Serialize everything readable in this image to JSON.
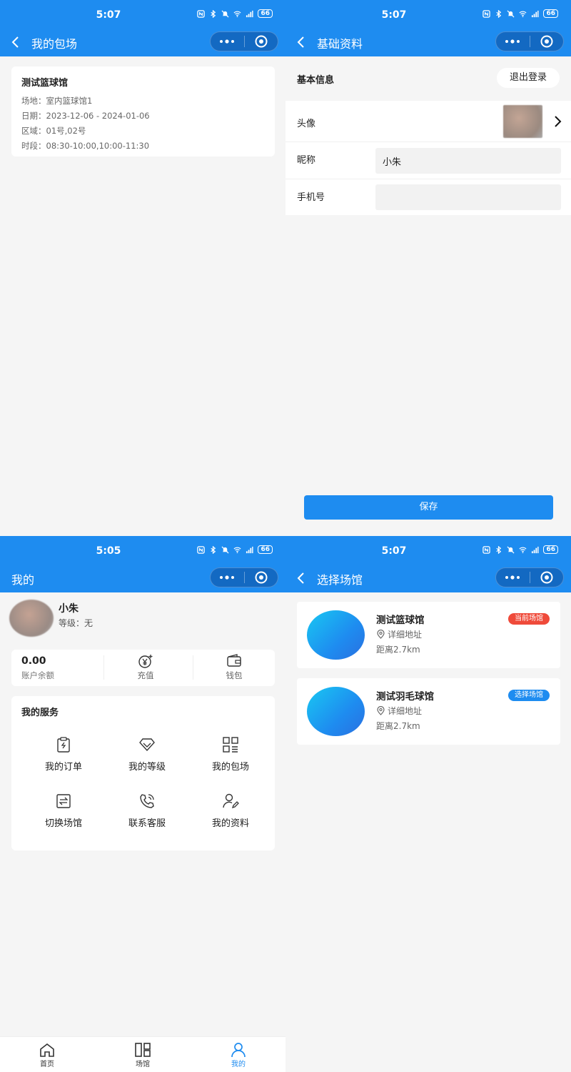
{
  "status": {
    "time_a": "5:07",
    "time_b": "5:05",
    "battery": "66"
  },
  "colors": {
    "brand_blue": "#1e8cf0",
    "current_badge_red": "#ef4a3a",
    "select_badge_blue": "#1e8cf0"
  },
  "screen_booking": {
    "nav_title": "我的包场",
    "card": {
      "name": "测试篮球馆",
      "venue_line": "场地：室内篮球馆1",
      "date_line": "日期：2023-12-06 - 2024-01-06",
      "area_line": "区域：01号,02号",
      "slot_line": "时段：08:30-10:00,10:00-11:30"
    }
  },
  "screen_profile_edit": {
    "nav_title": "基础资料",
    "section_title": "基本信息",
    "logout_label": "退出登录",
    "avatar_label": "头像",
    "nickname_label": "昵称",
    "nickname_value": "小朱",
    "phone_label": "手机号",
    "phone_value": "",
    "save_label": "保存"
  },
  "screen_mine": {
    "nav_title": "我的",
    "user_name": "小朱",
    "level_text": "等级：无",
    "balance_value": "0.00",
    "balance_label": "账户余额",
    "recharge_label": "充值",
    "wallet_label": "钱包",
    "services_title": "我的服务",
    "services": [
      {
        "label": "我的订单",
        "icon": "order-icon"
      },
      {
        "label": "我的等级",
        "icon": "diamond-icon"
      },
      {
        "label": "我的包场",
        "icon": "grid-icon"
      },
      {
        "label": "切换场馆",
        "icon": "switch-icon"
      },
      {
        "label": "联系客服",
        "icon": "phone-icon"
      },
      {
        "label": "我的资料",
        "icon": "user-edit-icon"
      }
    ],
    "tabs": [
      {
        "label": "首页",
        "icon": "home-icon"
      },
      {
        "label": "场馆",
        "icon": "venue-grid-icon"
      },
      {
        "label": "我的",
        "icon": "user-icon",
        "active": true
      }
    ]
  },
  "screen_select_venue": {
    "nav_title": "选择场馆",
    "venues": [
      {
        "name": "测试篮球馆",
        "address": "详细地址",
        "distance": "距离2.7km",
        "badge": "当前场馆"
      },
      {
        "name": "测试羽毛球馆",
        "address": "详细地址",
        "distance": "距离2.7km",
        "badge": "选择场馆"
      }
    ]
  }
}
